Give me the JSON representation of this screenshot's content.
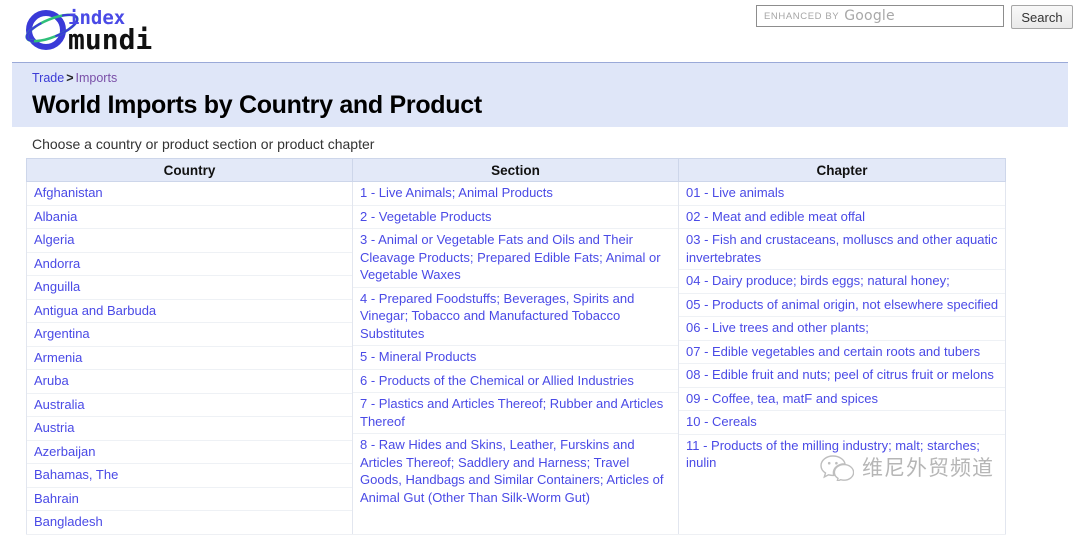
{
  "site": {
    "logo_word_one": "index",
    "logo_word_two": "mundi"
  },
  "search": {
    "placeholder_small": "ENHANCED BY",
    "placeholder_brand": "Google",
    "value": "",
    "button_label": "Search"
  },
  "breadcrumb": {
    "parent": "Trade",
    "separator": ">",
    "current": "Imports"
  },
  "page": {
    "title": "World Imports by Country and Product",
    "instruction": "Choose a country or product section or product chapter"
  },
  "table": {
    "headers": [
      "Country",
      "Section",
      "Chapter"
    ],
    "countries": [
      "Afghanistan",
      "Albania",
      "Algeria",
      "Andorra",
      "Anguilla",
      "Antigua and Barbuda",
      "Argentina",
      "Armenia",
      "Aruba",
      "Australia",
      "Austria",
      "Azerbaijan",
      "Bahamas, The",
      "Bahrain",
      "Bangladesh"
    ],
    "sections": [
      "1 - Live Animals; Animal Products",
      "2 - Vegetable Products",
      "3 - Animal or Vegetable Fats and Oils and Their Cleavage Products; Prepared Edible Fats; Animal or Vegetable Waxes",
      "4 - Prepared Foodstuffs; Beverages, Spirits and Vinegar; Tobacco and Manufactured Tobacco Substitutes",
      "5 - Mineral Products",
      "6 - Products of the Chemical or Allied Industries",
      "7 - Plastics and Articles Thereof; Rubber and Articles Thereof",
      "8 - Raw Hides and Skins, Leather, Furskins and Articles Thereof; Saddlery and Harness; Travel Goods, Handbags and Similar Containers; Articles of Animal Gut (Other Than Silk-Worm Gut)"
    ],
    "chapters": [
      "01 - Live animals",
      "02 - Meat and edible meat offal",
      "03 - Fish and crustaceans, molluscs and other aquatic invertebrates",
      "04 - Dairy produce; birds eggs; natural honey;",
      "05 - Products of animal origin, not elsewhere specified",
      "06 - Live trees and other plants;",
      "07 - Edible vegetables and certain roots and tubers",
      "08 - Edible fruit and nuts; peel of citrus fruit or melons",
      "09 - Coffee, tea, matF and spices",
      "10 - Cereals",
      "11 - Products of the milling industry; malt; starches; inulin"
    ]
  },
  "watermark": {
    "text": "维尼外贸频道"
  },
  "colors": {
    "link": "#4a4ae6",
    "visited_link": "#7a4fa8",
    "band_bg": "#dfe6f8",
    "header_bg": "#e3e9f8"
  }
}
